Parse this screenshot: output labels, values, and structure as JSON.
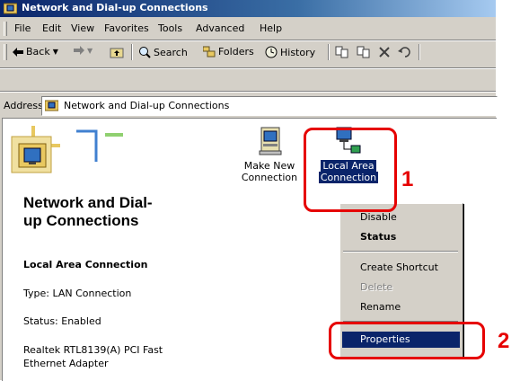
{
  "window": {
    "title": "Network and Dial-up Connections"
  },
  "menu": [
    "File",
    "Edit",
    "View",
    "Favorites",
    "Tools",
    "Advanced",
    "Help"
  ],
  "toolbar": {
    "back_label": "Back",
    "search_label": "Search",
    "folders_label": "Folders",
    "history_label": "History"
  },
  "address": {
    "label": "Address",
    "value": "Network and Dial-up Connections"
  },
  "panel": {
    "title_line1": "Network and Dial-",
    "title_line2": "up Connections",
    "selected_name": "Local Area Connection",
    "type": "Type: LAN Connection",
    "status": "Status: Enabled",
    "adapter_line1": "Realtek RTL8139(A) PCI Fast",
    "adapter_line2": "Ethernet Adapter"
  },
  "icons": {
    "make_new_line1": "Make New",
    "make_new_line2": "Connection",
    "lan_line1": "Local Area",
    "lan_line2": "Connection"
  },
  "context_menu": {
    "disable": "Disable",
    "status": "Status",
    "create_shortcut": "Create Shortcut",
    "delete": "Delete",
    "rename": "Rename",
    "properties": "Properties"
  },
  "callouts": {
    "step1": "1",
    "step2": "2"
  },
  "colors": {
    "highlight": "#0a246a",
    "callout_red": "#e60000",
    "window_face": "#d4d0c8"
  }
}
